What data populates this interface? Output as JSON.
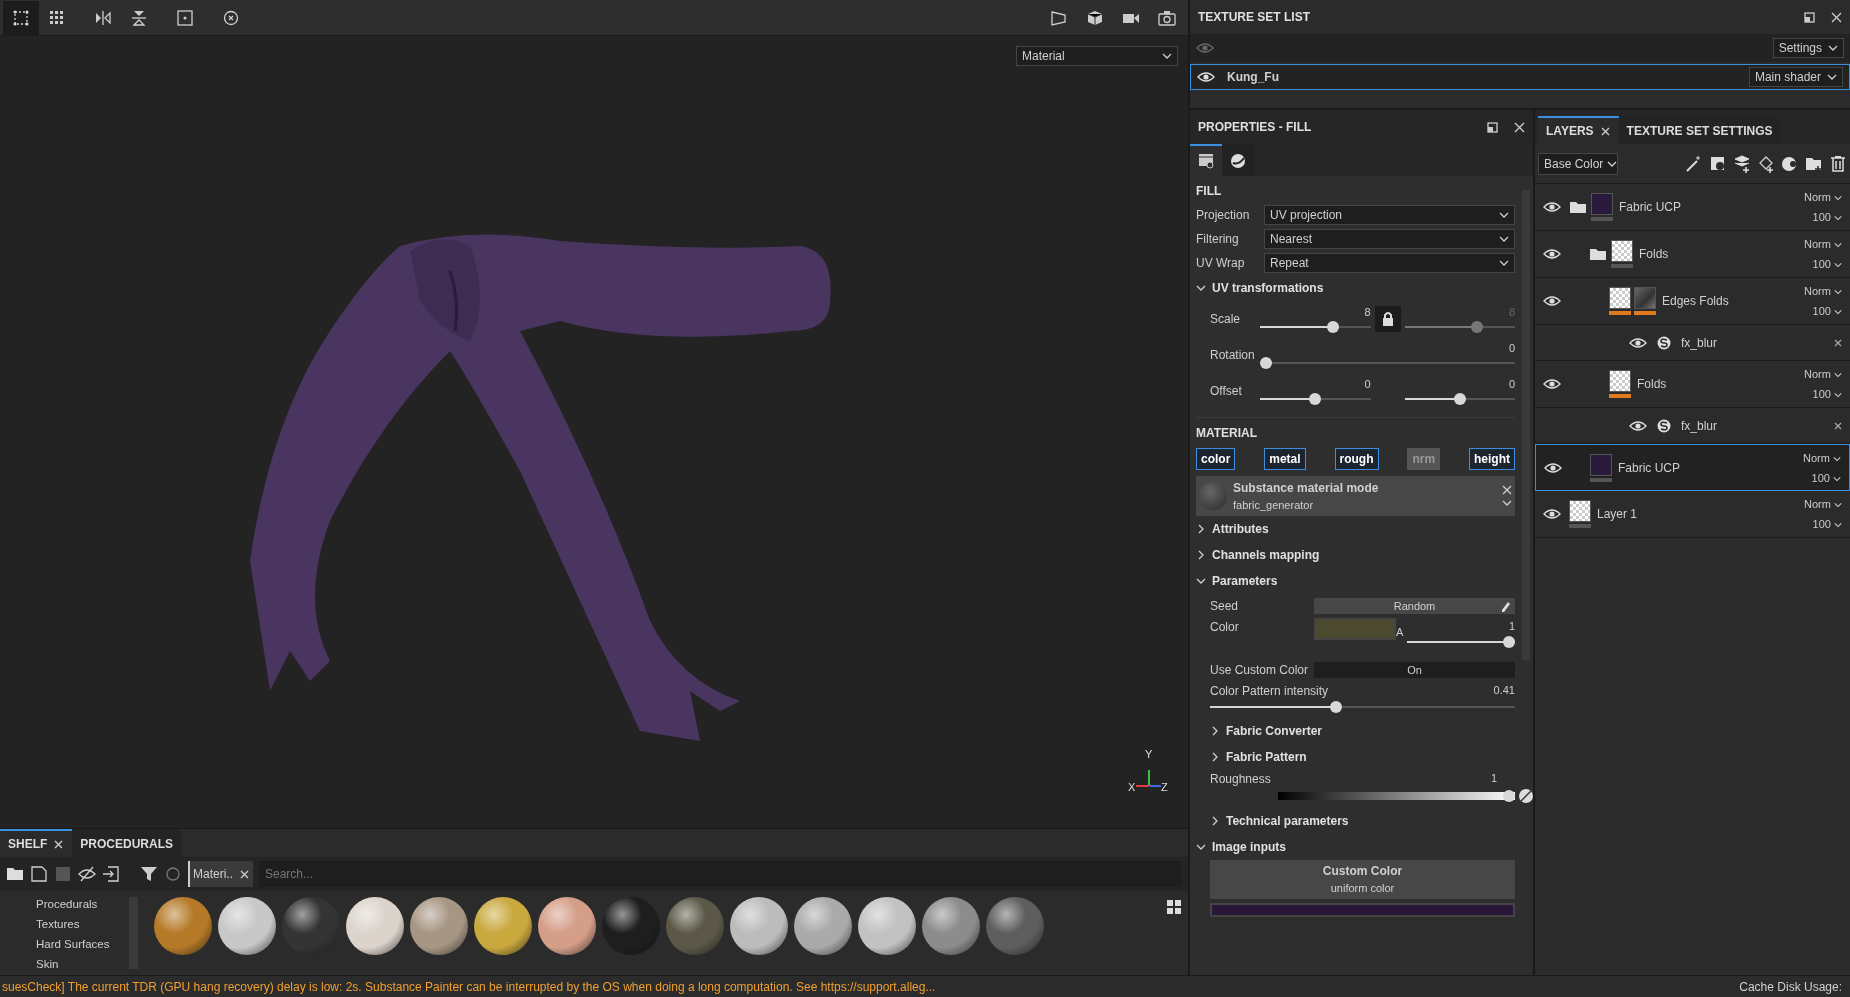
{
  "viewport": {
    "mode_dropdown": "Material",
    "axes": [
      {
        "label": "Y",
        "color": "#3cc43c"
      },
      {
        "label": "X",
        "color": "#e03c3c"
      },
      {
        "label": "Z",
        "color": "#3c6ce0"
      }
    ]
  },
  "shelf": {
    "tabs": [
      {
        "label": "SHELF",
        "selected": true
      },
      {
        "label": "PROCEDURALS",
        "selected": false
      }
    ],
    "filter_chip": "Materi..",
    "search_placeholder": "Search...",
    "categories": [
      "Procedurals",
      "Textures",
      "Hard Surfaces",
      "Skin"
    ],
    "materials": [
      {
        "color": "#b57a28"
      },
      {
        "color": "#c8c8c8"
      },
      {
        "color": "#343434"
      },
      {
        "color": "#dcd4cc"
      },
      {
        "color": "#a89684"
      },
      {
        "color": "#c9a83e"
      },
      {
        "color": "#d49e88"
      },
      {
        "color": "#1e1e1e"
      },
      {
        "color": "#5c5848"
      },
      {
        "color": "#bcbcbc"
      },
      {
        "color": "#aaaaaa"
      },
      {
        "color": "#c2c2c2"
      },
      {
        "color": "#8c8c8c"
      },
      {
        "color": "#5e5e5e"
      }
    ]
  },
  "texture_set_list": {
    "title": "TEXTURE SET LIST",
    "settings": "Settings",
    "sets": [
      {
        "name": "Kung_Fu",
        "shader": "Main shader",
        "selected": true
      }
    ]
  },
  "properties": {
    "title": "PROPERTIES - FILL",
    "tabs": [
      {
        "kind": "fill",
        "selected": true
      },
      {
        "kind": "material",
        "selected": false
      }
    ],
    "heading": "FILL",
    "dropdowns": [
      {
        "label": "Projection",
        "value": "UV projection"
      },
      {
        "label": "Filtering",
        "value": "Nearest"
      },
      {
        "label": "UV Wrap",
        "value": "Repeat"
      }
    ],
    "uv_transformations": {
      "title": "UV transformations",
      "expanded": true,
      "rows": [
        {
          "label": "Scale",
          "locked": true,
          "sliders": [
            {
              "reading": "8",
              "level": 0.68,
              "disabled": false
            },
            {
              "reading": "8",
              "level": 0.68,
              "disabled": true
            }
          ]
        },
        {
          "label": "Rotation",
          "sliders": [
            {
              "reading": "0",
              "level": 0,
              "disabled": false
            }
          ]
        },
        {
          "label": "Offset",
          "sliders": [
            {
              "reading": "0",
              "level": 0.5,
              "disabled": false
            },
            {
              "reading": "0",
              "level": 0.5,
              "disabled": false
            }
          ]
        }
      ]
    },
    "material_heading": "MATERIAL",
    "channels": [
      {
        "label": "color",
        "on": true
      },
      {
        "label": "metal",
        "on": true
      },
      {
        "label": "rough",
        "on": true
      },
      {
        "label": "nrm",
        "on": false
      },
      {
        "label": "height",
        "on": true
      }
    ],
    "substance": {
      "title": "Substance material mode",
      "value": "fabric_generator"
    },
    "sections": [
      {
        "title": "Attributes",
        "expanded": false
      },
      {
        "title": "Channels mapping",
        "expanded": false
      },
      {
        "title": "Parameters",
        "expanded": true,
        "items": [
          {
            "kind": "button",
            "label": "Seed",
            "value": "Random"
          },
          {
            "kind": "color",
            "label": "Color",
            "color": "#4b4a2f",
            "alpha_label": "A",
            "reading": "1",
            "level": 1
          },
          {
            "kind": "toggle",
            "label": "Use Custom Color",
            "value": "On"
          },
          {
            "kind": "slider",
            "label": "Color Pattern intensity",
            "reading": "0.41",
            "level": 0.41
          },
          {
            "kind": "group",
            "label": "Fabric Converter",
            "expanded": false
          },
          {
            "kind": "group",
            "label": "Fabric Pattern",
            "expanded": false
          },
          {
            "kind": "gradient",
            "label": "Roughness",
            "reading": "1",
            "level": 1
          },
          {
            "kind": "group",
            "label": "Technical parameters",
            "expanded": false
          }
        ]
      },
      {
        "title": "Image inputs",
        "expanded": true,
        "inputs": [
          {
            "title": "Custom Color",
            "subtitle": "uniform color",
            "color": "#2a1636"
          }
        ]
      }
    ]
  },
  "layers": {
    "tabs": [
      {
        "label": "LAYERS",
        "selected": true
      },
      {
        "label": "TEXTURE SET SETTINGS",
        "selected": false
      }
    ],
    "channel": "Base Color",
    "items": [
      {
        "kind": "folder",
        "name": "Fabric UCP",
        "blend": "Norm",
        "opacity": "100",
        "selected": false,
        "color": "#2a1a3c",
        "children": [
          {
            "kind": "folder",
            "name": "Folds",
            "blend": "Norm",
            "opacity": "100",
            "selected": false,
            "children": [
              {
                "kind": "fill",
                "name": "Edges Folds",
                "blend": "Norm",
                "opacity": "100",
                "selected": false,
                "mask": true,
                "generator": true,
                "effects": [
                  {
                    "name": "fx_blur"
                  }
                ]
              },
              {
                "kind": "fill",
                "name": "Folds",
                "blend": "Norm",
                "opacity": "100",
                "selected": false,
                "mask": true,
                "effects": [
                  {
                    "name": "fx_blur"
                  }
                ]
              }
            ]
          },
          {
            "kind": "fill",
            "name": "Fabric UCP",
            "blend": "Norm",
            "opacity": "100",
            "selected": true,
            "color": "#2a1a3c"
          }
        ]
      },
      {
        "kind": "fill",
        "name": "Layer 1",
        "blend": "Norm",
        "opacity": "100",
        "selected": false
      }
    ]
  },
  "status_bar": {
    "message": "suesCheck] The current TDR (GPU hang recovery) delay is low: 2s. Substance Painter can be interrupted by the OS when doing a long computation. See https://support.alleg...",
    "right": "Cache Disk Usage:"
  }
}
